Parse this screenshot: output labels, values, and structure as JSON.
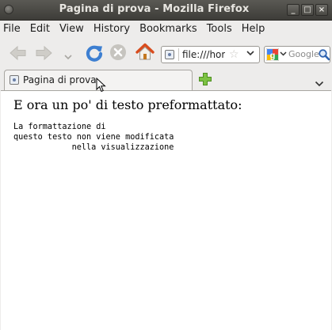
{
  "window": {
    "title": "Pagina di prova - Mozilla Firefox",
    "controls": {
      "minimize": "_",
      "maximize": "□",
      "close": "×"
    }
  },
  "menubar": {
    "items": [
      "File",
      "Edit",
      "View",
      "History",
      "Bookmarks",
      "Tools",
      "Help"
    ]
  },
  "navbar": {
    "url": "file:///home/",
    "search_placeholder": "Google",
    "search_engine_icon": "google-icon",
    "icons": [
      "back-arrow-icon",
      "forward-arrow-icon",
      "history-dropdown-icon",
      "reload-icon",
      "stop-icon",
      "home-icon",
      "bookmark-star-icon",
      "search-magnifier-icon"
    ]
  },
  "tabs": {
    "items": [
      {
        "label": "Pagina di prova",
        "active": true
      }
    ],
    "new_tab_icon": "plus-icon",
    "list_all_icon": "chevron-down-icon"
  },
  "content": {
    "heading": "E ora un po' di testo preformattato:",
    "preformatted": "La formattazione di\nquesto testo non viene modificata\n            nella visualizzazione"
  },
  "colors": {
    "titlebar": "#3d3c38",
    "window_bg": "#edeceb",
    "page_bg": "#ffffff",
    "new_tab_plus": "#6fb43a",
    "reload_blue": "#3d7fd1",
    "home_roof": "#d84c1d"
  }
}
